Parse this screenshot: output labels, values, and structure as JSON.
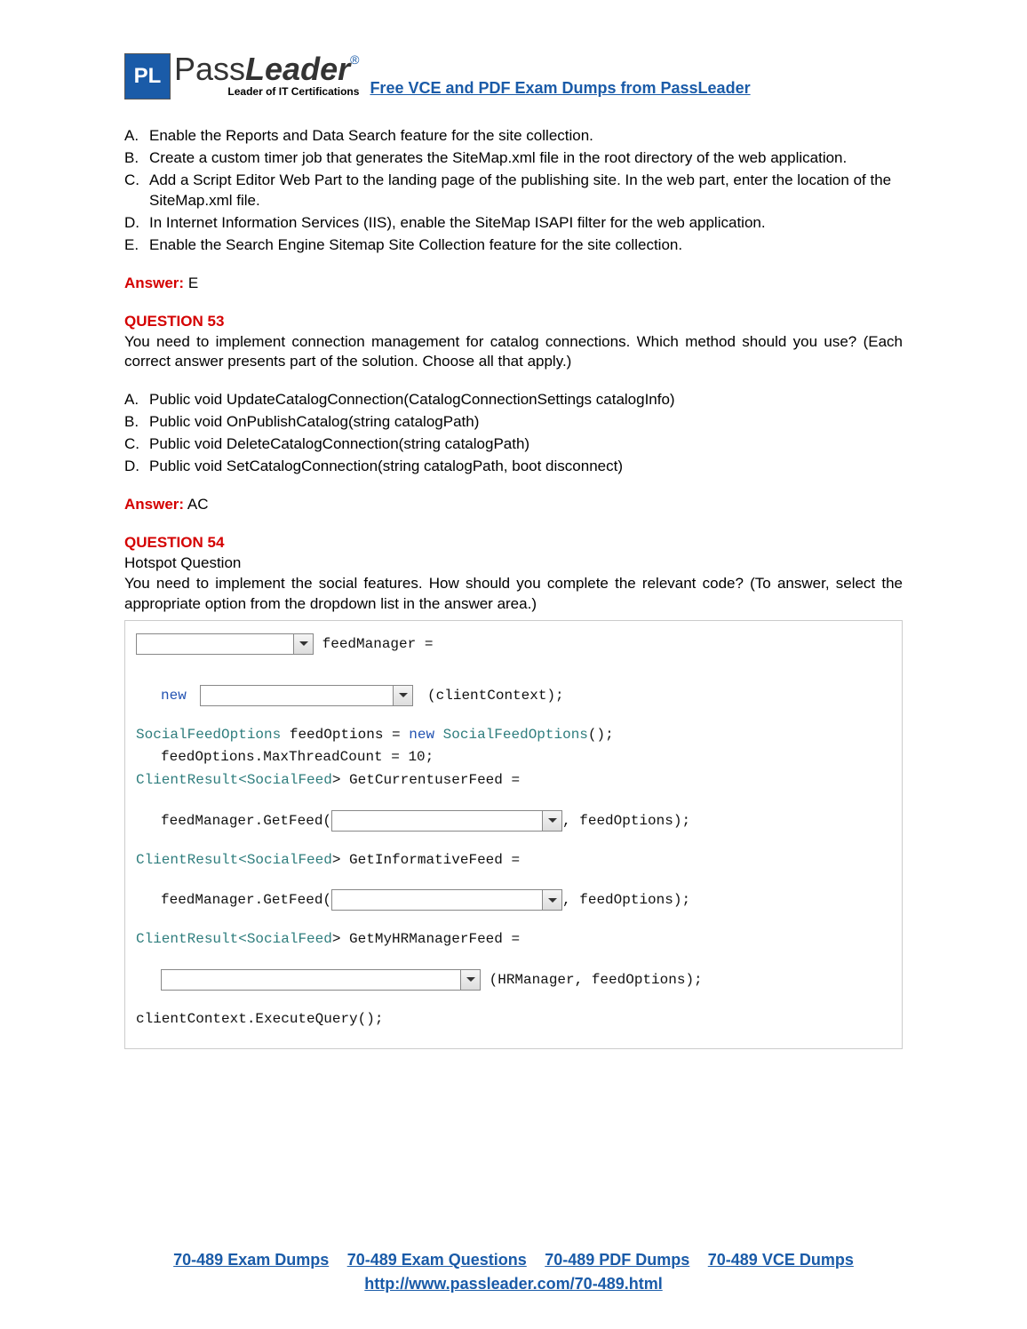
{
  "header": {
    "logo_initials": "PL",
    "brand_pass": "Pass",
    "brand_leader": "Leader",
    "brand_reg": "®",
    "tagline": "Leader of IT Certifications",
    "header_link": "Free VCE and PDF Exam Dumps from PassLeader"
  },
  "q52": {
    "options": {
      "A": "Enable the Reports and Data Search feature for the site collection.",
      "B": "Create a custom timer job that generates the SiteMap.xml file in the root directory of the web application.",
      "C": "Add a Script Editor Web Part to the landing page of the publishing site. In the web part, enter the location of the SiteMap.xml file.",
      "D": "In Internet Information Services (IIS), enable the SiteMap ISAPI filter for the web application.",
      "E": "Enable the Search Engine Sitemap Site Collection feature for the site collection."
    },
    "answer_label": "Answer:",
    "answer_value": "E"
  },
  "q53": {
    "label": "QUESTION 53",
    "prompt": "You need to implement connection management for catalog connections. Which method should you use? (Each correct answer presents part of the solution. Choose all that apply.)",
    "options": {
      "A": "Public void UpdateCatalogConnection(CatalogConnectionSettings catalogInfo)",
      "B": "Public void OnPublishCatalog(string catalogPath)",
      "C": "Public void DeleteCatalogConnection(string catalogPath)",
      "D": "Public void SetCatalogConnection(string catalogPath, boot disconnect)"
    },
    "answer_label": "Answer:",
    "answer_value": "AC"
  },
  "q54": {
    "label": "QUESTION 54",
    "subtype": "Hotspot Question",
    "prompt": "You need to implement the social features. How should you complete the relevant code? (To answer, select the appropriate option from the dropdown list in the answer area.)",
    "code": {
      "line1_after": "feedManager =",
      "line2_new": "new",
      "line2_after": "(clientContext);",
      "line3a": "SocialFeedOptions",
      "line3b": " feedOptions = ",
      "line3c": "new",
      "line3d": " SocialFeedOptions",
      "line3e": "();",
      "line4": "feedOptions.MaxThreadCount = 10;",
      "line5a": "ClientResult<",
      "line5b": "SocialFeed",
      "line5c": "> GetCurrentuserFeed =",
      "line6_pre": "feedManager.GetFeed(",
      "line6_post": ", feedOptions);",
      "line7a": "ClientResult<",
      "line7b": "SocialFeed",
      "line7c": "> GetInformativeFeed =",
      "line8_pre": "feedManager.GetFeed(",
      "line8_post": ", feedOptions);",
      "line9a": "ClientResult<",
      "line9b": "SocialFeed",
      "line9c": "> GetMyHRManagerFeed =",
      "line10_post": "(HRManager, feedOptions);",
      "line11": "clientContext.ExecuteQuery();"
    }
  },
  "footer": {
    "link1": "70-489 Exam Dumps",
    "link2": "70-489 Exam Questions",
    "link3": "70-489 PDF Dumps",
    "link4": "70-489 VCE Dumps",
    "url": "http://www.passleader.com/70-489.html"
  }
}
